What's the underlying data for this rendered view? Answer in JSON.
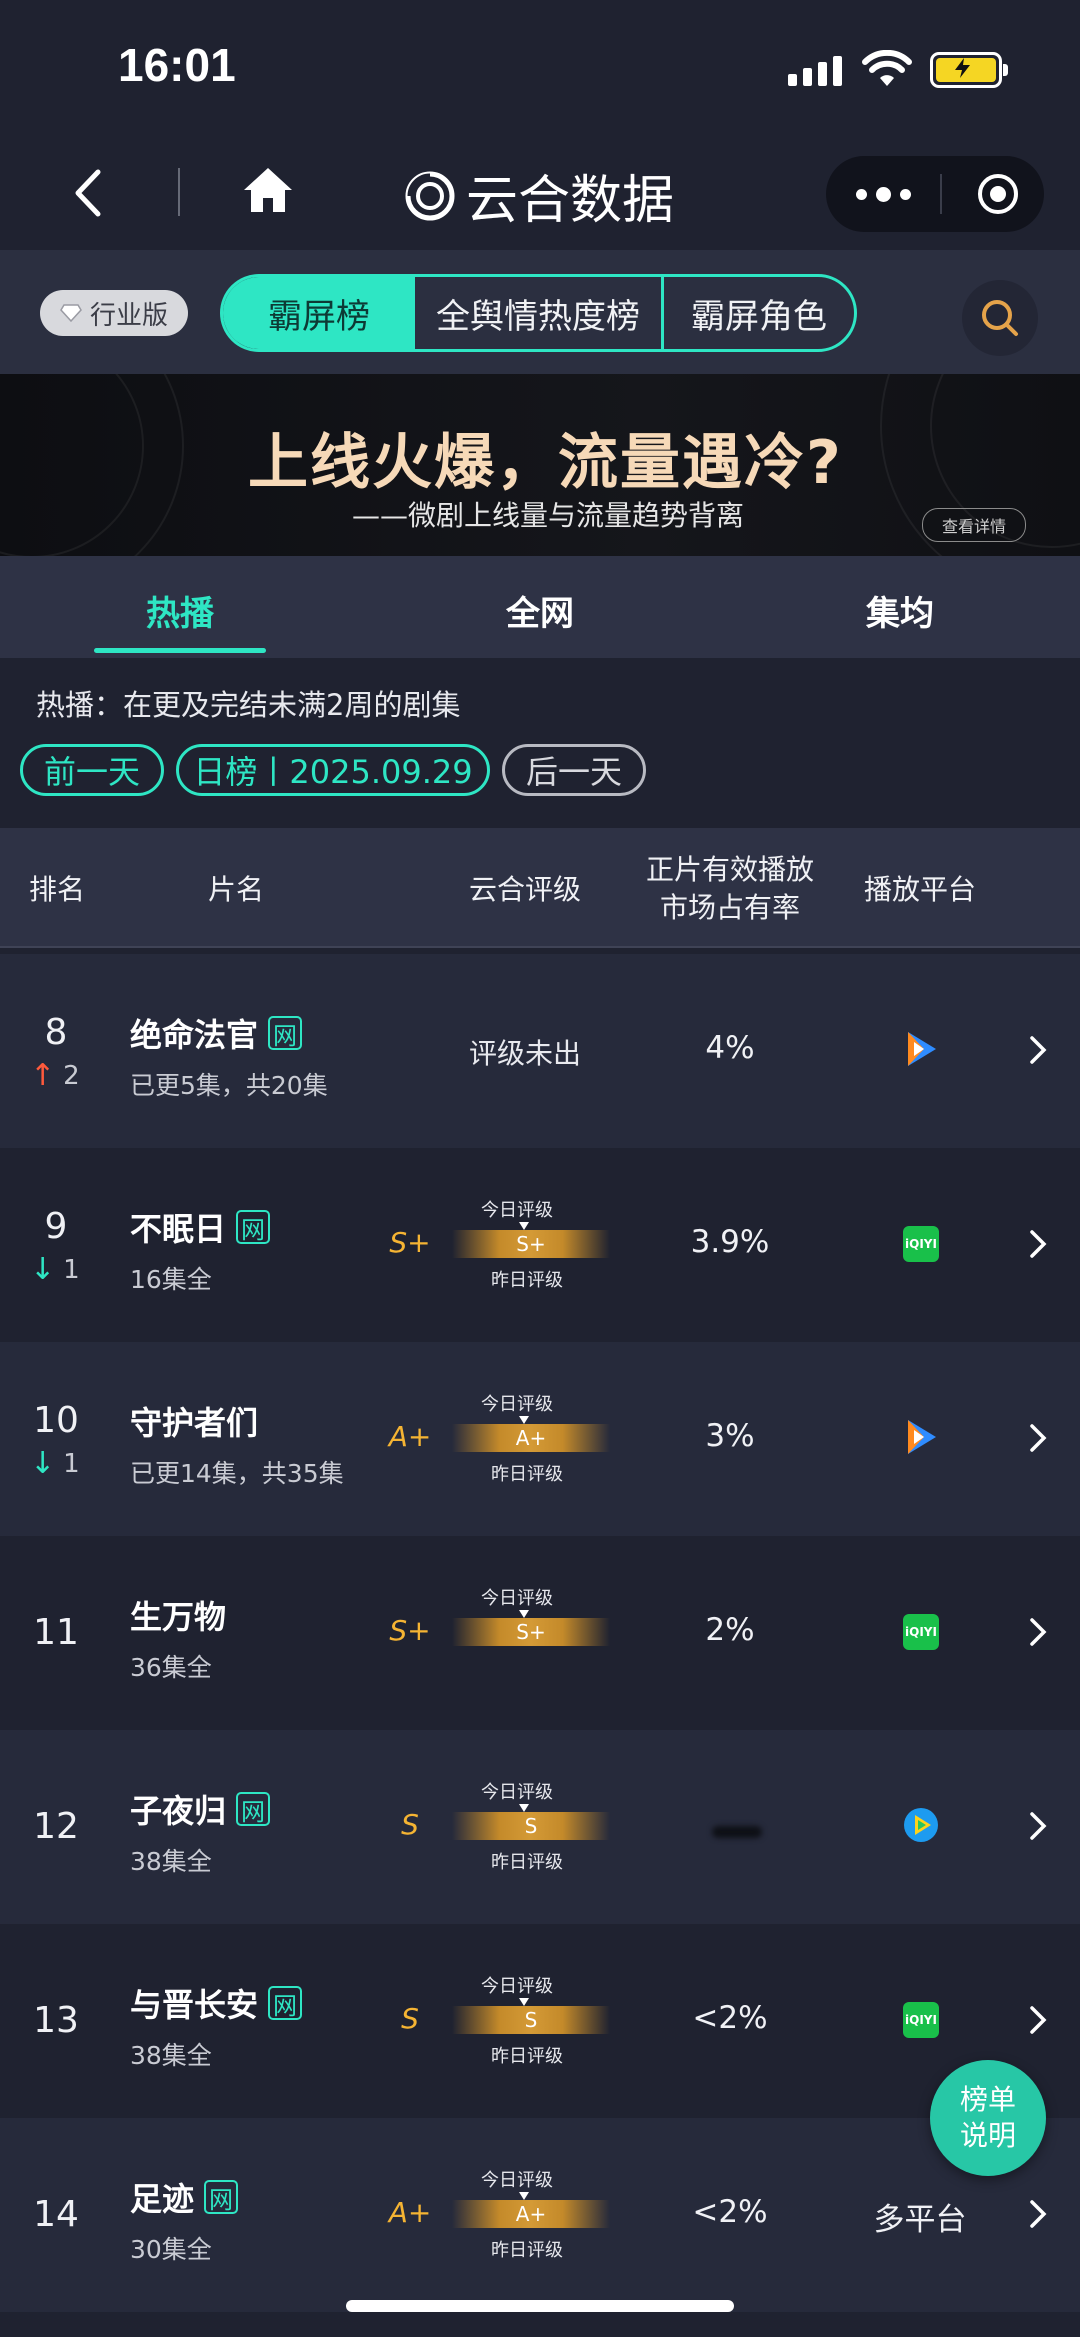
{
  "status_bar": {
    "time": "16:01"
  },
  "nav": {
    "brand": "云合数据"
  },
  "top_tabs": {
    "industry_badge": "行业版",
    "segments": [
      "霸屏榜",
      "全舆情热度榜",
      "霸屏角色"
    ]
  },
  "banner": {
    "title": "上线火爆，流量遇冷?",
    "subtitle": "——微剧上线量与流量趋势背离",
    "button": "查看详情"
  },
  "sub_tabs": [
    "热播",
    "全网",
    "集均"
  ],
  "description": "热播：在更及完结未满2周的剧集",
  "date_controls": {
    "prev": "前一天",
    "current": "日榜丨2025.09.29",
    "next": "后一天"
  },
  "table_header": {
    "rank": "排名",
    "title": "片名",
    "rating": "云合评级",
    "share_line1": "正片有效播放",
    "share_line2": "市场占有率",
    "platform": "播放平台"
  },
  "grade_labels": {
    "today": "今日评级",
    "yesterday": "昨日评级"
  },
  "rows": [
    {
      "rank": "8",
      "change": "2",
      "title": "绝命法官",
      "badge": "网",
      "episodes": "已更5集，共20集",
      "rating_text": "评级未出",
      "share": "4%",
      "platform": "tencent-video-icon"
    },
    {
      "rank": "9",
      "change": "1",
      "title": "不眠日",
      "badge": "网",
      "episodes": "16集全",
      "grade": "S+",
      "grade_today": "S+",
      "share": "3.9%",
      "platform": "iqiyi-icon",
      "platform_label": "iQIYI"
    },
    {
      "rank": "10",
      "change": "1",
      "title": "守护者们",
      "episodes": "已更14集，共35集",
      "grade": "A+",
      "grade_today": "A+",
      "share": "3%",
      "platform": "tencent-video-icon"
    },
    {
      "rank": "11",
      "title": "生万物",
      "episodes": "36集全",
      "grade": "S+",
      "grade_today": "S+",
      "share": "2%",
      "platform": "iqiyi-icon",
      "platform_label": "iQIYI"
    },
    {
      "rank": "12",
      "title": "子夜归",
      "badge": "网",
      "episodes": "38集全",
      "grade": "S",
      "grade_today": "S",
      "share": "",
      "platform": "tencent-play-icon"
    },
    {
      "rank": "13",
      "title": "与晋长安",
      "badge": "网",
      "episodes": "38集全",
      "grade": "S",
      "grade_today": "S",
      "share": "<2%",
      "platform": "iqiyi-icon",
      "platform_label": "iQIYI"
    },
    {
      "rank": "14",
      "title": "足迹",
      "badge": "网",
      "episodes": "30集全",
      "grade": "A+",
      "grade_today": "A+",
      "share": "<2%",
      "platform_text": "多平台"
    }
  ],
  "float_button": {
    "line1": "榜单",
    "line2": "说明"
  },
  "colors": {
    "accent": "#2ee6c4",
    "grade": "#f5b433",
    "up": "#ff5a3c",
    "background": "#1f2230"
  }
}
